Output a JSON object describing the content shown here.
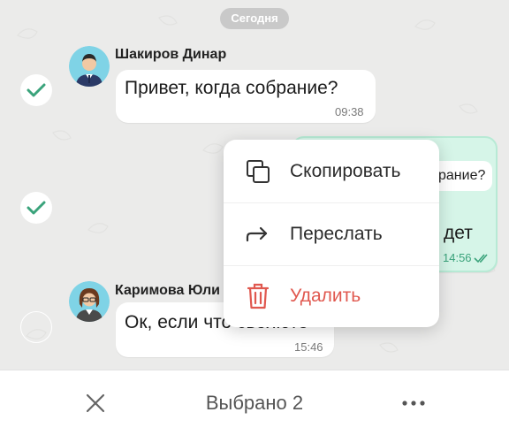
{
  "date_separator": "Сегодня",
  "messages": [
    {
      "sender": "Шакиров Динар",
      "text": "Привет, когда собрание?",
      "time": "09:38",
      "selected": true
    },
    {
      "quote_text": "рание?",
      "text": "дет",
      "time": "14:56",
      "selected": true,
      "outgoing": true
    },
    {
      "sender": "Каримова Юли",
      "text": "Ок, если что свояюте",
      "time": "15:46",
      "selected": false
    }
  ],
  "context_menu": {
    "items": [
      {
        "label": "Скопировать",
        "icon": "copy-icon"
      },
      {
        "label": "Переслать",
        "icon": "forward-icon"
      },
      {
        "label": "Удалить",
        "icon": "trash-icon"
      }
    ]
  },
  "bottom_bar": {
    "title": "Выбрано 2",
    "close_icon": "close-icon",
    "more_icon": "more-icon"
  },
  "colors": {
    "accent": "#3aa37b",
    "danger": "#e0584f",
    "outgoing_bubble": "#d6f5e8"
  }
}
